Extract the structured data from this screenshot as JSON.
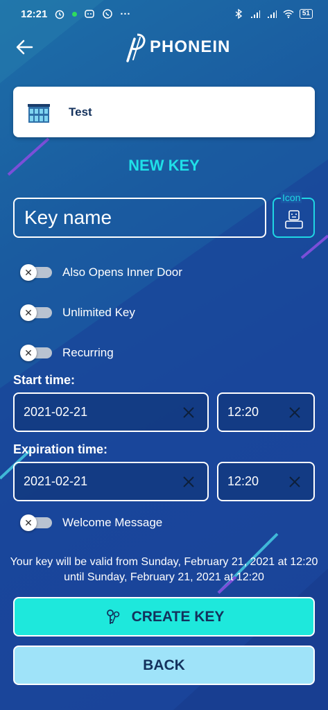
{
  "status_bar": {
    "time": "12:21",
    "more": "···",
    "battery": "51"
  },
  "header": {
    "logo_text": "PHONEIN"
  },
  "building": {
    "name": "Test"
  },
  "title": "NEW KEY",
  "key_name": {
    "placeholder": "Key name"
  },
  "icon_picker": {
    "label": "Icon"
  },
  "toggles": [
    {
      "label": "Also Opens Inner Door",
      "on": false
    },
    {
      "label": "Unlimited Key",
      "on": false
    },
    {
      "label": "Recurring",
      "on": false
    }
  ],
  "start_time": {
    "label": "Start time:",
    "date": "2021-02-21",
    "time": "12:20"
  },
  "expiration_time": {
    "label": "Expiration time:",
    "date": "2021-02-21",
    "time": "12:20"
  },
  "welcome_toggle": {
    "label": "Welcome Message",
    "on": false
  },
  "validity_text": "Your key will be valid from Sunday, February 21, 2021 at 12:20 until Sunday, February 21, 2021 at 12:20",
  "buttons": {
    "create": "CREATE KEY",
    "back": "BACK"
  },
  "colors": {
    "accent": "#1fe0e8",
    "create_button": "#1ee8dc",
    "back_button": "#9fe3f9",
    "navy_text": "#13315c"
  }
}
